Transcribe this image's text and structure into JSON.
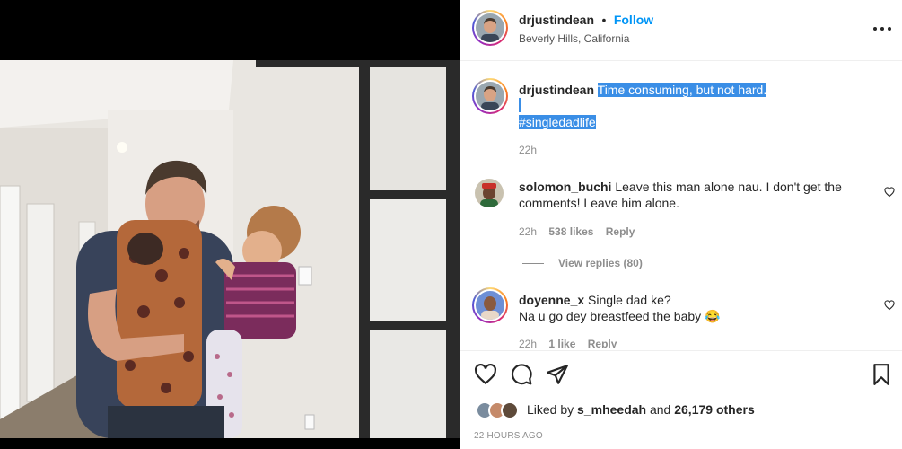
{
  "post": {
    "username": "drjustindean",
    "follow_label": "Follow",
    "separator": "•",
    "location": "Beverly Hills, California"
  },
  "caption": {
    "username": "drjustindean",
    "line1": "Time consuming, but not hard.",
    "hashtag": "#singledadlife",
    "time": "22h"
  },
  "comments": [
    {
      "username": "solomon_buchi",
      "text": "Leave this man alone nau. I don't get the comments! Leave him alone.",
      "time": "22h",
      "likes": "538 likes",
      "reply": "Reply",
      "view_replies": "View replies (80)"
    },
    {
      "username": "doyenne_x",
      "line1": "Single dad ke?",
      "line2": "Na u go dey breastfeed the baby 😂",
      "time": "22h",
      "likes": "1 like",
      "reply": "Reply"
    }
  ],
  "likes": {
    "prefix": "Liked by",
    "user": "s_mheedah",
    "and": "and",
    "others": "26,179 others"
  },
  "timestamp": "22 HOURS AGO",
  "colors": {
    "accent": "#0095f6",
    "selection": "#3a8ee6",
    "text": "#262626",
    "muted": "#8e8e8e"
  },
  "icons": [
    "heart-icon",
    "comment-icon",
    "share-icon",
    "bookmark-icon",
    "more-icon"
  ]
}
